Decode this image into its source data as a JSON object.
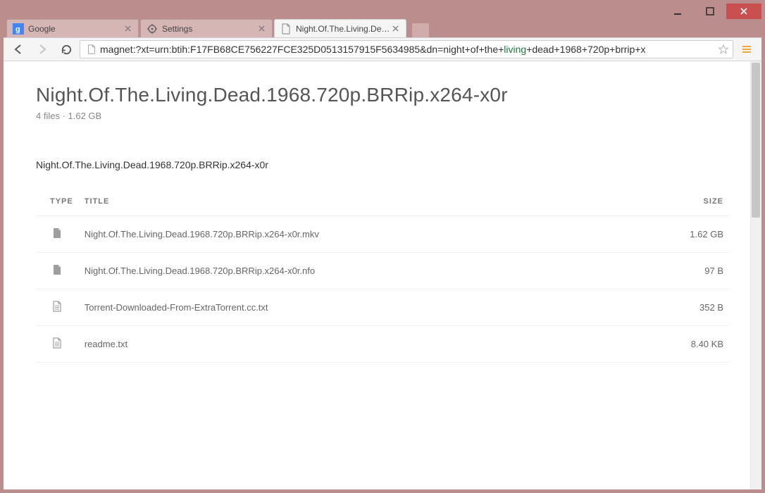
{
  "window": {
    "tabs": [
      {
        "label": "Google",
        "icon": "google"
      },
      {
        "label": "Settings",
        "icon": "gear"
      },
      {
        "label": "Night.Of.The.Living.Dead.",
        "icon": "page"
      }
    ],
    "active_tab": 2
  },
  "omnibox": {
    "url_prefix": "magnet:",
    "url_query": "?xt=urn:btih:F17FB68CE756227FCE325D0513157915F5634985&dn=night+of+the+",
    "url_highlight": "living",
    "url_suffix": "+dead+1968+720p+brrip+x"
  },
  "page": {
    "title": "Night.Of.The.Living.Dead.1968.720p.BRRip.x264-x0r",
    "subtitle": "4 files · 1.62 GB",
    "folder": "Night.Of.The.Living.Dead.1968.720p.BRRip.x264-x0r",
    "columns": {
      "type": "TYPE",
      "title": "TITLE",
      "size": "SIZE"
    },
    "files": [
      {
        "icon": "file",
        "title": "Night.Of.The.Living.Dead.1968.720p.BRRip.x264-x0r.mkv",
        "size": "1.62 GB"
      },
      {
        "icon": "file",
        "title": "Night.Of.The.Living.Dead.1968.720p.BRRip.x264-x0r.nfo",
        "size": "97 B"
      },
      {
        "icon": "text",
        "title": "Torrent-Downloaded-From-ExtraTorrent.cc.txt",
        "size": "352 B"
      },
      {
        "icon": "text",
        "title": "readme.txt",
        "size": "8.40 KB"
      }
    ]
  }
}
